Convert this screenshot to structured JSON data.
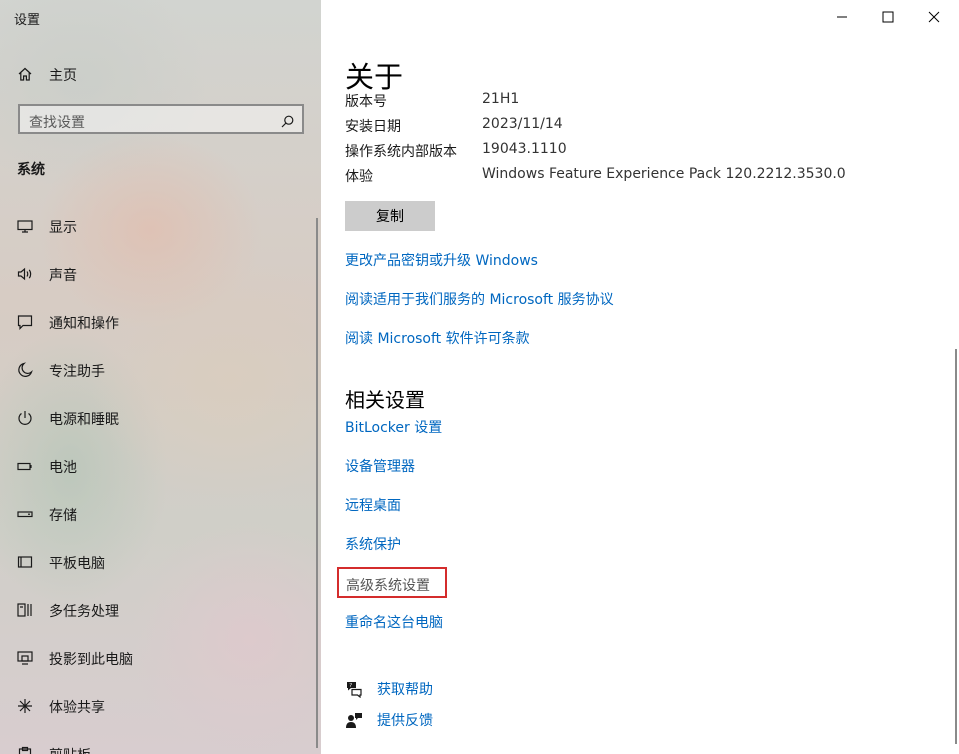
{
  "window": {
    "title": "设置",
    "controls": {
      "minimize": "minimize",
      "maximize": "maximize",
      "close": "close"
    }
  },
  "sidebar": {
    "home_label": "主页",
    "search_placeholder": "查找设置",
    "section_label": "系统",
    "items": [
      {
        "label": "显示",
        "icon": "display-icon"
      },
      {
        "label": "声音",
        "icon": "speaker-icon"
      },
      {
        "label": "通知和操作",
        "icon": "notification-icon"
      },
      {
        "label": "专注助手",
        "icon": "moon-icon"
      },
      {
        "label": "电源和睡眠",
        "icon": "power-icon"
      },
      {
        "label": "电池",
        "icon": "battery-icon"
      },
      {
        "label": "存储",
        "icon": "storage-icon"
      },
      {
        "label": "平板电脑",
        "icon": "tablet-icon"
      },
      {
        "label": "多任务处理",
        "icon": "multitask-icon"
      },
      {
        "label": "投影到此电脑",
        "icon": "project-icon"
      },
      {
        "label": "体验共享",
        "icon": "share-icon"
      },
      {
        "label": "剪贴板",
        "icon": "clipboard-icon"
      }
    ]
  },
  "main": {
    "title": "关于",
    "specs": [
      {
        "key": "版本号",
        "value": "21H1"
      },
      {
        "key": "安装日期",
        "value": "2023/11/14"
      },
      {
        "key": "操作系统内部版本",
        "value": "19043.1110"
      },
      {
        "key": "体验",
        "value": "Windows Feature Experience Pack 120.2212.3530.0"
      }
    ],
    "copy_label": "复制",
    "links": [
      "更改产品密钥或升级 Windows",
      "阅读适用于我们服务的 Microsoft 服务协议",
      "阅读 Microsoft 软件许可条款"
    ],
    "related_title": "相关设置",
    "related_links": [
      "BitLocker 设置",
      "设备管理器",
      "远程桌面",
      "系统保护",
      "高级系统设置",
      "重命名这台电脑"
    ],
    "help": [
      {
        "label": "获取帮助",
        "icon": "help-chat-icon"
      },
      {
        "label": "提供反馈",
        "icon": "feedback-icon"
      }
    ]
  },
  "colors": {
    "link": "#0067c0",
    "highlight_border": "#d42c2c",
    "button_bg": "#cccccc"
  }
}
